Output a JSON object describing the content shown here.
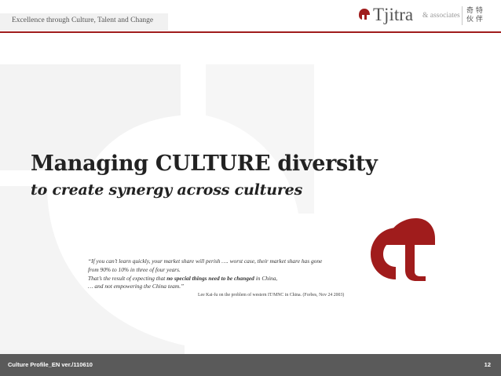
{
  "header": {
    "tagline": "Excellence through Culture, Talent and Change"
  },
  "logo": {
    "name": "Tjitra",
    "associates": "& associates",
    "chinese_line1": "奇 特",
    "chinese_line2": "伙 伴"
  },
  "main": {
    "title": "Managing CULTURE diversity",
    "subtitle": "to create synergy across cultures"
  },
  "quote": {
    "line1": "“If you can’t learn quickly, your market share will perish …. worst case, their market share has gone",
    "line2": "from 90% to 10% in three of four years.",
    "line3_prefix": "That’s the result of expecting that ",
    "line3_bold": "no special things need to be changed",
    "line3_suffix": " in China,",
    "line4": "… and not empowering the China team.”",
    "source": "Lee Kai-fu on the problem of western IT/MNC in China. (Forbes, Nov 24 2003)"
  },
  "footer": {
    "doc_label": "Culture Profile_EN ver./110610",
    "page_number": "12"
  },
  "colors": {
    "brand_red": "#a01c1c",
    "footer_gray": "#5a5a5a",
    "watermark": "#f3f3f3"
  }
}
